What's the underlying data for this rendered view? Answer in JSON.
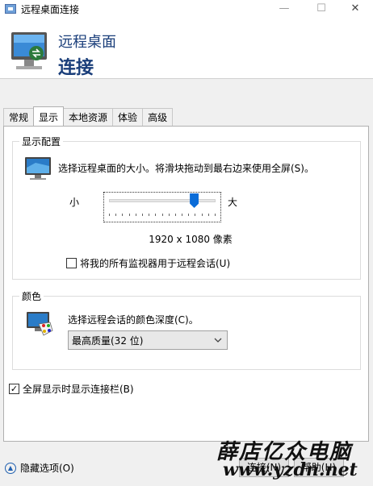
{
  "window": {
    "title": "远程桌面连接",
    "minimize_glyph": "—",
    "maximize_glyph": "☐",
    "close_glyph": "✕"
  },
  "header": {
    "line1": "远程桌面",
    "line2": "连接"
  },
  "tabs": [
    {
      "label": "常规",
      "active": false
    },
    {
      "label": "显示",
      "active": true
    },
    {
      "label": "本地资源",
      "active": false
    },
    {
      "label": "体验",
      "active": false
    },
    {
      "label": "高级",
      "active": false
    }
  ],
  "display_config": {
    "legend": "显示配置",
    "description": "选择远程桌面的大小。将滑块拖动到最右边来使用全屏(S)。",
    "small_label": "小",
    "large_label": "大",
    "slider_level": 0.8,
    "resolution": "1920 x 1080 像素",
    "use_all_monitors_label": "将我的所有监视器用于远程会话(U)",
    "use_all_monitors_checked": false
  },
  "colors": {
    "legend": "颜色",
    "description": "选择远程会话的颜色深度(C)。",
    "selected_depth": "最高质量(32 位)"
  },
  "fullscreen_bar": {
    "label": "全屏显示时显示连接栏(B)",
    "checked": true,
    "check_glyph": "✓"
  },
  "footer": {
    "hide_options_label": "隐藏选项(O)",
    "hide_options_glyph": "▲",
    "connect_label": "连接(N)",
    "help_label": "帮助(H)"
  },
  "watermark": {
    "line1": "薛店亿众电脑",
    "line2": "www.yzdn.net"
  },
  "icons": {
    "app": "remote-desktop-icon",
    "header": "monitor-connect-icon",
    "display": "monitor-icon",
    "colors": "palette-monitor-icon",
    "select_arrow": "chevron-down-icon"
  }
}
